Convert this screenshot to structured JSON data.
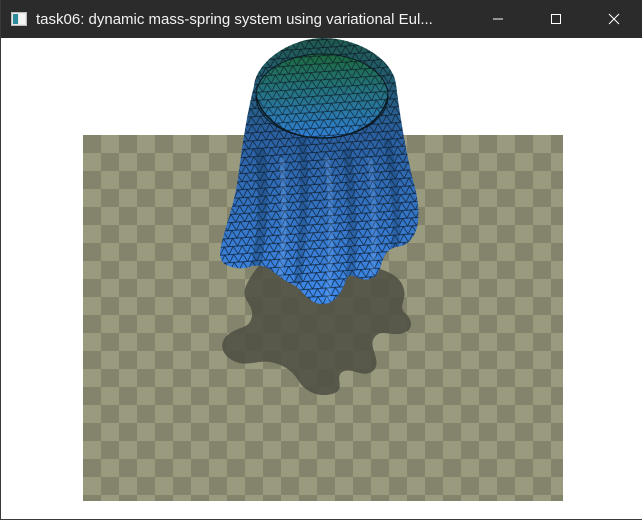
{
  "window": {
    "title": "task06: dynamic mass-spring system using variational Eul..."
  },
  "icons": {
    "app": "app-window-icon",
    "minimize": "minimize-icon",
    "maximize": "maximize-icon",
    "close": "close-icon"
  },
  "scene": {
    "description_only": false,
    "colors": {
      "background": "#ffffff",
      "titlebar": "#2b2b2b",
      "floor_light": "#9a9a7e",
      "floor_dark": "#80806a",
      "shadow": "#4f4f44",
      "cloth_top": "#1f5a4e",
      "cloth_bottom": "#3f8cf0",
      "mesh_line": "#0d1a24"
    }
  }
}
